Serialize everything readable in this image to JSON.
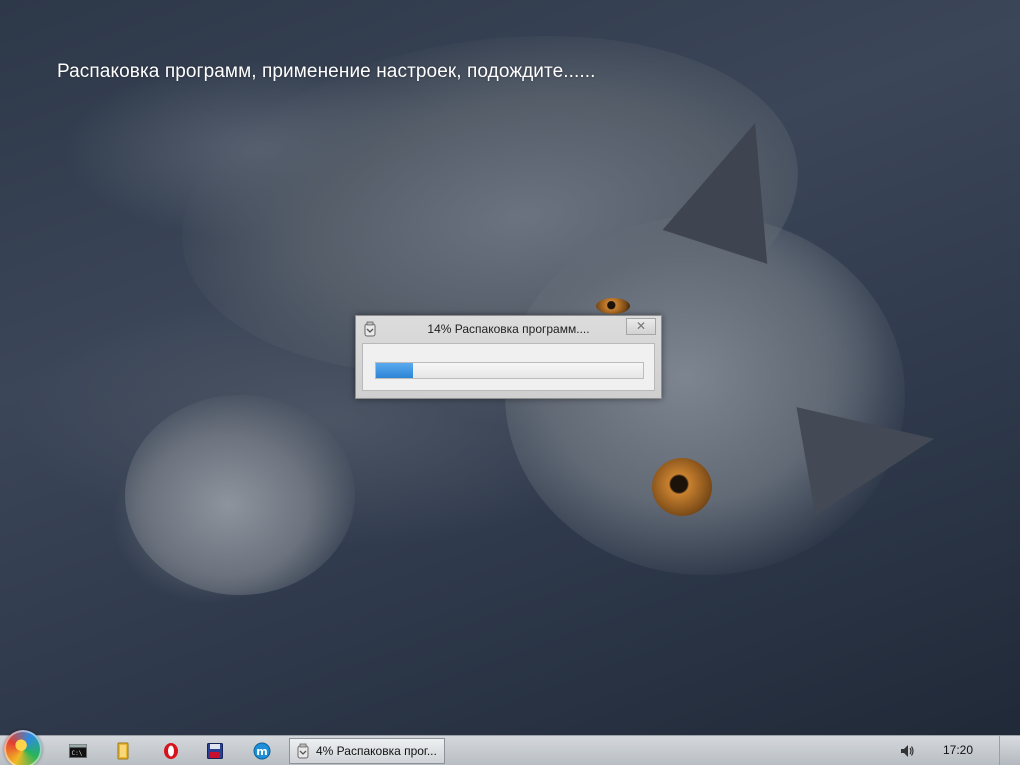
{
  "desktop": {
    "status_message": "Распаковка программ, применение настроек, подождите......"
  },
  "dialog": {
    "title": "14% Распаковка программ....",
    "close_glyph": "✕",
    "progress": 0.14
  },
  "taskbar": {
    "pinned": [
      {
        "name": "cmd-icon"
      },
      {
        "name": "folder-icon"
      },
      {
        "name": "opera-icon"
      },
      {
        "name": "floppy-disk-icon"
      },
      {
        "name": "media-app-icon"
      }
    ],
    "active_task_label": "4% Распаковка прог...",
    "clock": "17:20"
  },
  "colors": {
    "progress_fill": "#2d85d6",
    "opera_red": "#d6131b",
    "folder_yellow": "#e8b631"
  }
}
